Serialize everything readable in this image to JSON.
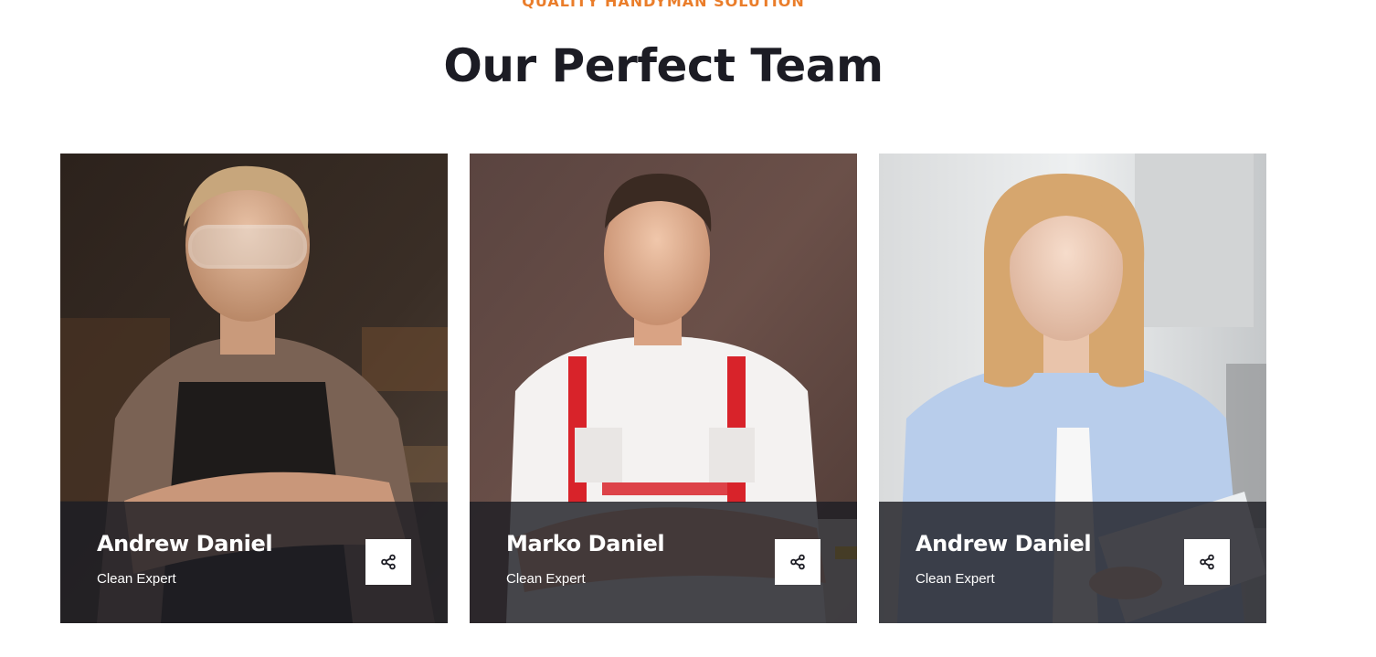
{
  "section": {
    "eyebrow": "QUALITY HANDYMAN SOLUTION",
    "title": "Our Perfect Team"
  },
  "team": [
    {
      "name": "Andrew Daniel",
      "role": "Clean Expert",
      "share_icon": "share-icon"
    },
    {
      "name": "Marko Daniel",
      "role": "Clean Expert",
      "share_icon": "share-icon"
    },
    {
      "name": "Andrew Daniel",
      "role": "Clean Expert",
      "share_icon": "share-icon"
    }
  ],
  "colors": {
    "accent": "#ea7d2a",
    "heading": "#1c1c24",
    "overlay": "#1e1e24"
  }
}
